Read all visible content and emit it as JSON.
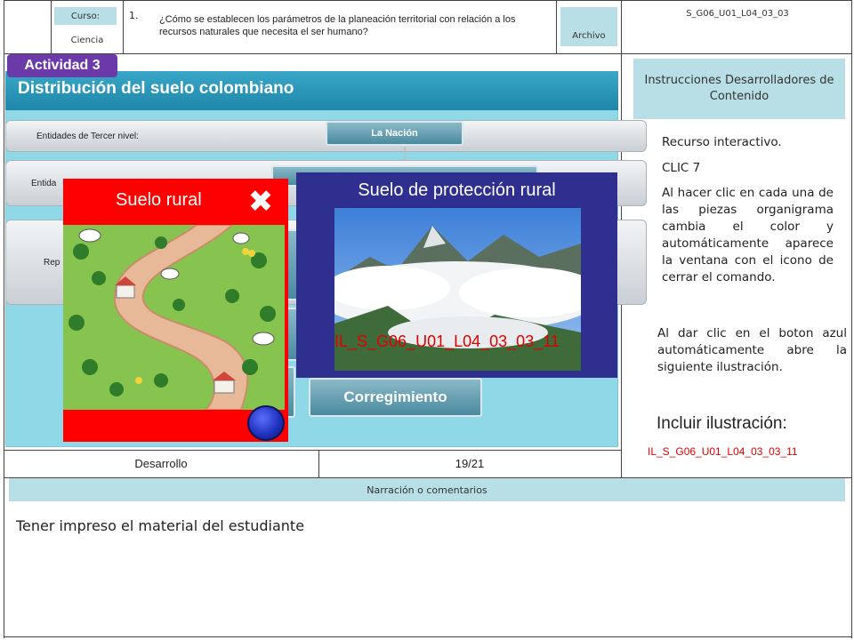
{
  "header": {
    "curso_label": "Curso:",
    "curso_value": "Ciencia",
    "number": "1.",
    "question": "¿Cómo se establecen los parámetros de la planeación territorial con relación a los recursos naturales que necesita el ser humano?",
    "archivo_label": "Archivo",
    "code": "S_G06_U01_L04_03_03"
  },
  "stage": {
    "badge": "Actividad 3",
    "title": "Distribución del suelo colombiano",
    "row1_label": "Entidades de Tercer nivel:",
    "row1_node": "La Nación",
    "row2_label": "Entida",
    "row3_label": "Rep",
    "corregimiento": "Corregimiento"
  },
  "popup_rural": {
    "title": "Suelo rural"
  },
  "popup_proteccion": {
    "title": "Suelo de protección rural",
    "overlay_code": "IL_S_G06_U01_L04_03_03_11"
  },
  "right": {
    "instr_head": "Instrucciones Desarrolladores de Contenido",
    "line1": "Recurso interactivo.",
    "line2": "CLIC 7",
    "paragraph1": "Al hacer clic en cada una de las piezas organigrama cambia el color y automáticamente aparece la ventana con el icono de cerrar el comando.",
    "paragraph2": "Al dar clic en el boton azul automáticamente abre la siguiente ilustración.",
    "incluir": "Incluir ilustración:",
    "incluir_code": "IL_S_G06_U01_L04_03_03_11"
  },
  "footer": {
    "desarrollo": "Desarrollo",
    "page": "19/21",
    "narracion_head": "Narración o comentarios",
    "narracion_text": "Tener impreso el material del estudiante"
  },
  "colors": {
    "chip": "#b8dfe6",
    "stage": "#8fd8e8",
    "rural_popup": "#ff0000",
    "proteccion_popup": "#2e2f8f",
    "overlay_text": "#e00000"
  }
}
